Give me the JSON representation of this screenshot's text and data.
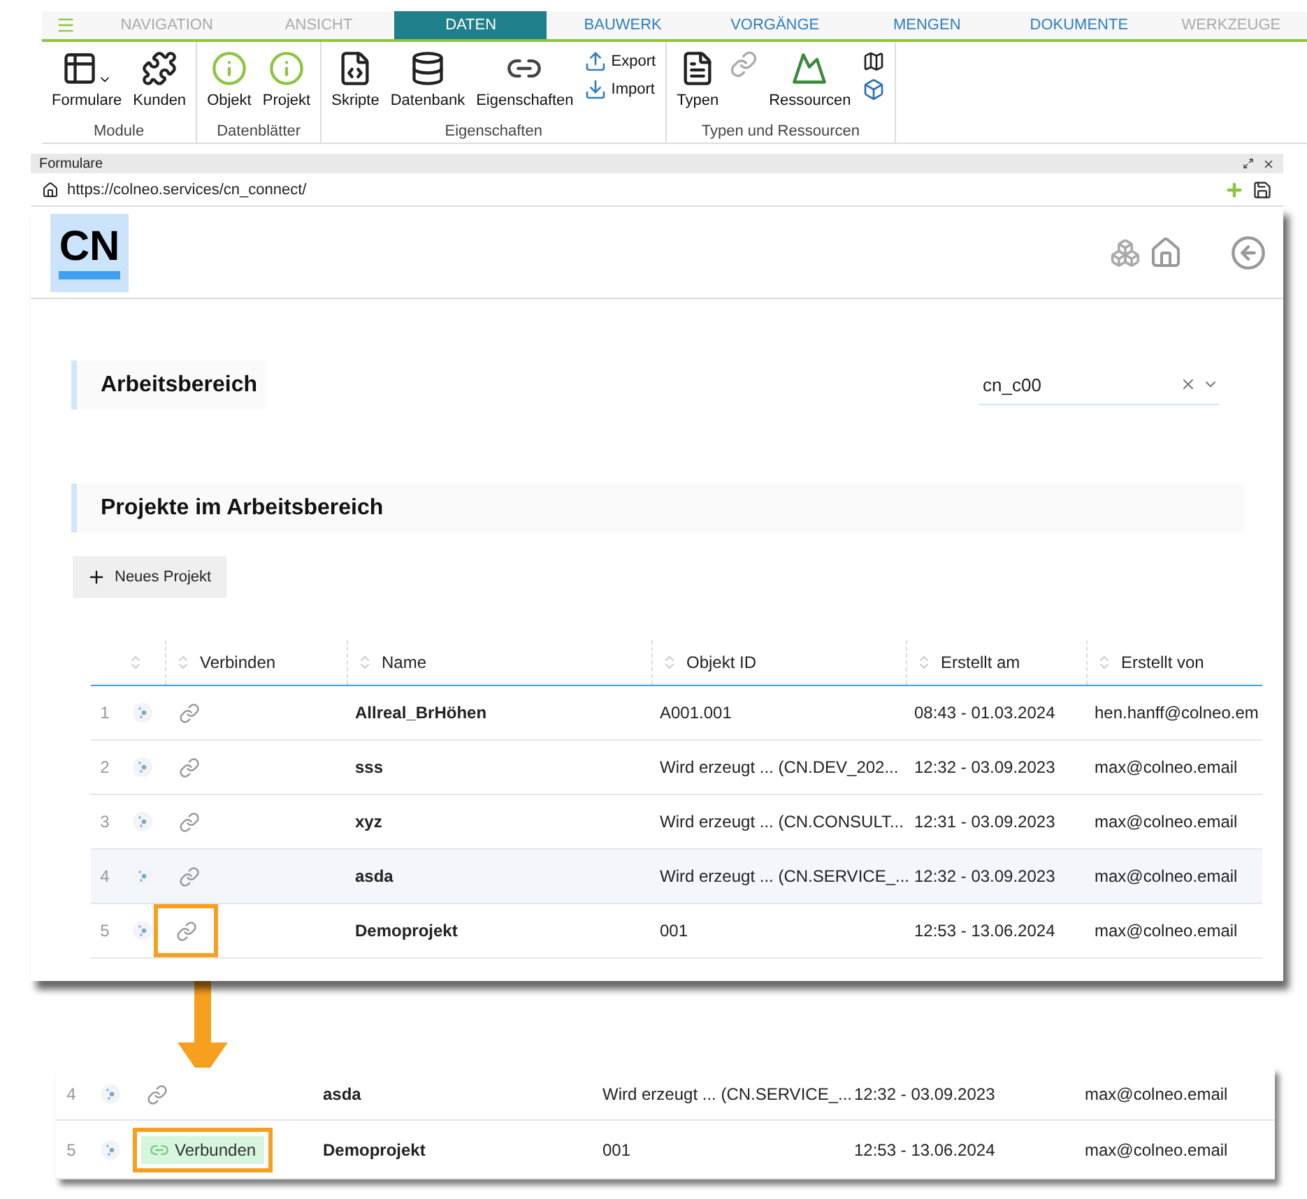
{
  "tabs": [
    {
      "label": "NAVIGATION",
      "selected": false,
      "disabled": true
    },
    {
      "label": "ANSICHT",
      "selected": false,
      "disabled": true
    },
    {
      "label": "DATEN",
      "selected": true,
      "disabled": false
    },
    {
      "label": "BAUWERK",
      "selected": false,
      "disabled": false
    },
    {
      "label": "VORGÄNGE",
      "selected": false,
      "disabled": false
    },
    {
      "label": "MENGEN",
      "selected": false,
      "disabled": false
    },
    {
      "label": "DOKUMENTE",
      "selected": false,
      "disabled": false
    },
    {
      "label": "WERKZEUGE",
      "selected": false,
      "disabled": true
    }
  ],
  "ribbon_groups": [
    {
      "label": "Module",
      "items": [
        {
          "kind": "split",
          "label": "Formulare"
        },
        {
          "kind": "large",
          "label": "Kunden"
        }
      ]
    },
    {
      "label": "Datenblätter",
      "items": [
        {
          "kind": "large",
          "label": "Objekt"
        },
        {
          "kind": "large",
          "label": "Projekt"
        }
      ]
    },
    {
      "label": "Eigenschaften",
      "items": [
        {
          "kind": "large",
          "label": "Skripte"
        },
        {
          "kind": "large",
          "label": "Datenbank"
        },
        {
          "kind": "large",
          "label": "Eigenschaften"
        },
        {
          "kind": "stack",
          "buttons": [
            {
              "kind": "labeled",
              "label": "Export"
            },
            {
              "kind": "labeled",
              "label": "Import"
            }
          ]
        }
      ]
    },
    {
      "label": "Typen und Ressourcen",
      "items": [
        {
          "kind": "large",
          "label": "Typen"
        },
        {
          "kind": "icon"
        },
        {
          "kind": "large",
          "label": "Ressourcen"
        },
        {
          "kind": "stack",
          "buttons": [
            {
              "kind": "icon"
            },
            {
              "kind": "icon"
            }
          ]
        }
      ]
    }
  ],
  "panel": {
    "title": "Formulare"
  },
  "address_bar": {
    "url": "https://colneo.services/cn_connect/"
  },
  "app": {
    "logo": "CN",
    "workspace": {
      "heading": "Arbeitsbereich",
      "value": "cn_c00"
    },
    "projects": {
      "heading": "Projekte im Arbeitsbereich",
      "new_button": "Neues Projekt",
      "columns": [
        {
          "label": "Verbinden"
        },
        {
          "label": "Name"
        },
        {
          "label": "Objekt ID"
        },
        {
          "label": "Erstellt am"
        },
        {
          "label": "Erstellt von"
        }
      ],
      "rows": [
        {
          "number": "1",
          "name": "Allreal_BrHöhen",
          "object_id": "A001.001",
          "created_at": "08:43 - 01.03.2024",
          "created_by": "hen.hanff@colneo.em",
          "connected": false,
          "highlighted": false,
          "hovered": false
        },
        {
          "number": "2",
          "name": "sss",
          "object_id": "Wird erzeugt ... (CN.DEV_202...",
          "created_at": "12:32 - 03.09.2023",
          "created_by": "max@colneo.email",
          "connected": false,
          "highlighted": false,
          "hovered": false
        },
        {
          "number": "3",
          "name": "xyz",
          "object_id": "Wird erzeugt ... (CN.CONSULT...",
          "created_at": "12:31 - 03.09.2023",
          "created_by": "max@colneo.email",
          "connected": false,
          "highlighted": false,
          "hovered": false
        },
        {
          "number": "4",
          "name": "asda",
          "object_id": "Wird erzeugt ... (CN.SERVICE_...",
          "created_at": "12:32 - 03.09.2023",
          "created_by": "max@colneo.email",
          "connected": false,
          "highlighted": false,
          "hovered": true
        },
        {
          "number": "5",
          "name": "Demoprojekt",
          "object_id": "001",
          "created_at": "12:53 - 13.06.2024",
          "created_by": "max@colneo.email",
          "connected": false,
          "highlighted": true,
          "hovered": false
        }
      ]
    }
  },
  "result_rows": [
    {
      "number": "4",
      "name": "asda",
      "object_id": "Wird erzeugt ... (CN.SERVICE_...",
      "created_at": "12:32 - 03.09.2023",
      "created_by": "max@colneo.email",
      "connected": false,
      "highlighted": false
    },
    {
      "number": "5",
      "name": "Demoprojekt",
      "object_id": "001",
      "created_at": "12:53 - 13.06.2024",
      "created_by": "max@colneo.email",
      "connected": true,
      "status_label": "Verbunden",
      "highlighted": true
    }
  ]
}
